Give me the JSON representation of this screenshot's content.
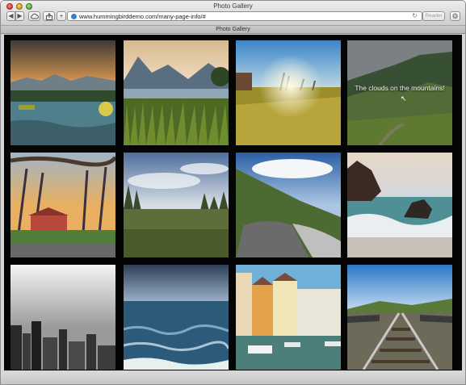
{
  "window": {
    "title": "Photo Gallery",
    "url": "www.hummingbirddemo.com/many-page-info/#",
    "reader_label": "Reader",
    "tab_title": "Photo Gallery"
  },
  "toolbar": {
    "back_icon": "back-arrow-icon",
    "forward_icon": "forward-arrow-icon",
    "cloud_icon": "cloud-icon",
    "share_icon": "share-icon",
    "new_tab_icon": "plus-icon",
    "settings_icon": "gear-icon",
    "reload_icon": "reload-icon"
  },
  "gallery": {
    "hover_caption": "The clouds on the mountains!",
    "photos": [
      {
        "subject": "lake-sunset"
      },
      {
        "subject": "mountain-lake-grass"
      },
      {
        "subject": "sunrise-field"
      },
      {
        "subject": "cloudy-mountains"
      },
      {
        "subject": "autumn-trees-cabin"
      },
      {
        "subject": "meadow-clouds"
      },
      {
        "subject": "coastal-road"
      },
      {
        "subject": "sea-rocks"
      },
      {
        "subject": "city-skyline-bw"
      },
      {
        "subject": "ocean-waves"
      },
      {
        "subject": "canal-houses"
      },
      {
        "subject": "railway-tracks"
      }
    ]
  }
}
